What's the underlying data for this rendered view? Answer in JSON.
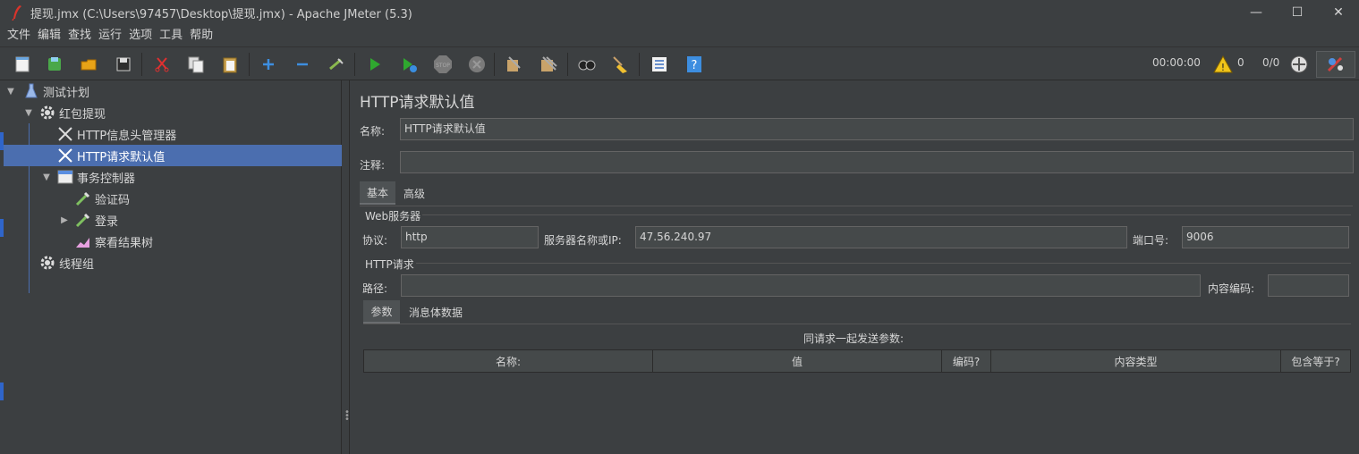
{
  "window": {
    "title": "提现.jmx (C:\\Users\\97457\\Desktop\\提现.jmx) - Apache JMeter (5.3)",
    "minimize": "—",
    "maximize": "☐",
    "close": "✕"
  },
  "menu": [
    "文件",
    "编辑",
    "查找",
    "运行",
    "选项",
    "工具",
    "帮助"
  ],
  "toolbar": {
    "timer": "00:00:00",
    "warnings": "0",
    "threads": "0/0"
  },
  "tree": {
    "items": [
      {
        "label": "测试计划",
        "icon": "flask-icon"
      },
      {
        "label": "红包提现",
        "icon": "gear-icon"
      },
      {
        "label": "HTTP信息头管理器",
        "icon": "wrench-icon"
      },
      {
        "label": "HTTP请求默认值",
        "icon": "wrench-icon"
      },
      {
        "label": "事务控制器",
        "icon": "controller-icon"
      },
      {
        "label": "验证码",
        "icon": "pipette-icon"
      },
      {
        "label": "登录",
        "icon": "pipette-icon"
      },
      {
        "label": "察看结果树",
        "icon": "chart-icon"
      },
      {
        "label": "线程组",
        "icon": "gear-icon"
      }
    ]
  },
  "main": {
    "title": "HTTP请求默认值",
    "name_label": "名称:",
    "name_value": "HTTP请求默认值",
    "comment_label": "注释:",
    "comment_value": "",
    "tabs": [
      "基本",
      "高级"
    ],
    "web_server_group": "Web服务器",
    "protocol_label": "协议:",
    "protocol_value": "http",
    "server_label": "服务器名称或IP:",
    "server_value": "47.56.240.97",
    "port_label": "端口号:",
    "port_value": "9006",
    "http_request_group": "HTTP请求",
    "path_label": "路径:",
    "path_value": "",
    "encoding_label": "内容编码:",
    "encoding_value": "",
    "sub_tabs": [
      "参数",
      "消息体数据"
    ],
    "params_caption": "同请求一起发送参数:",
    "columns": [
      "名称:",
      "值",
      "编码?",
      "内容类型",
      "包含等于?"
    ]
  },
  "colors": {
    "background": "#3c3f41",
    "selection": "#4b6eaf",
    "field": "#45494a"
  }
}
